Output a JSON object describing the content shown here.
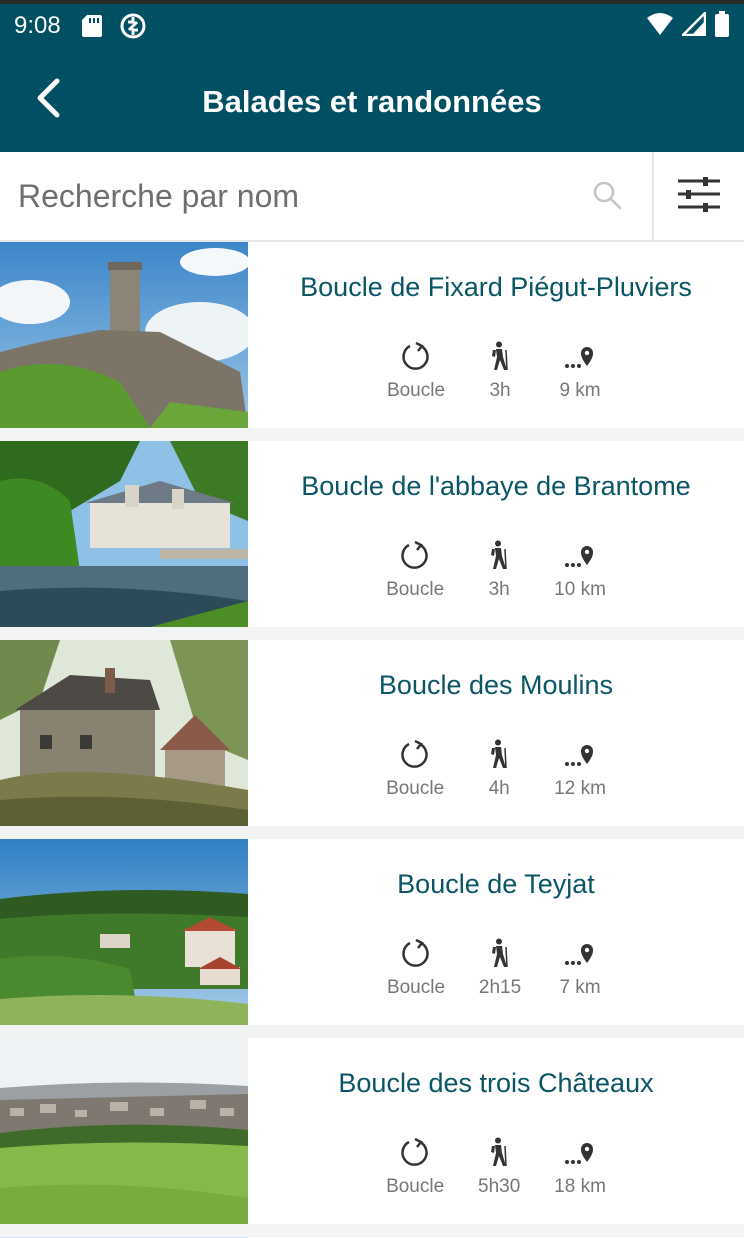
{
  "status_bar": {
    "time": "9:08",
    "icons": [
      "sd-card-icon",
      "sync-icon",
      "wifi-icon",
      "signal-icon",
      "battery-icon"
    ]
  },
  "app_bar": {
    "title": "Balades et randonnées",
    "back_icon": "chevron-left-icon"
  },
  "search": {
    "placeholder": "Recherche par nom",
    "value": "",
    "icons": [
      "search-icon",
      "filter-sliders-icon"
    ]
  },
  "colors": {
    "primary": "#004f62",
    "title_text": "#0a5566",
    "muted_text": "#777777",
    "background": "#f2f4f4"
  },
  "trails": [
    {
      "name": "Boucle de Fixard Piégut-Pluviers",
      "type": "Boucle",
      "duration": "3h",
      "distance": "9 km",
      "image": "castle-tower-photo"
    },
    {
      "name": "Boucle de l'abbaye de Brantome",
      "type": "Boucle",
      "duration": "3h",
      "distance": "10 km",
      "image": "abbey-river-photo"
    },
    {
      "name": "Boucle des Moulins",
      "type": "Boucle",
      "duration": "4h",
      "distance": "12 km",
      "image": "stone-mill-photo"
    },
    {
      "name": "Boucle de Teyjat",
      "type": "Boucle",
      "duration": "2h15",
      "distance": "7 km",
      "image": "village-hills-photo"
    },
    {
      "name": "Boucle des trois Châteaux",
      "type": "Boucle",
      "duration": "5h30",
      "distance": "18 km",
      "image": "town-meadow-photo"
    }
  ]
}
